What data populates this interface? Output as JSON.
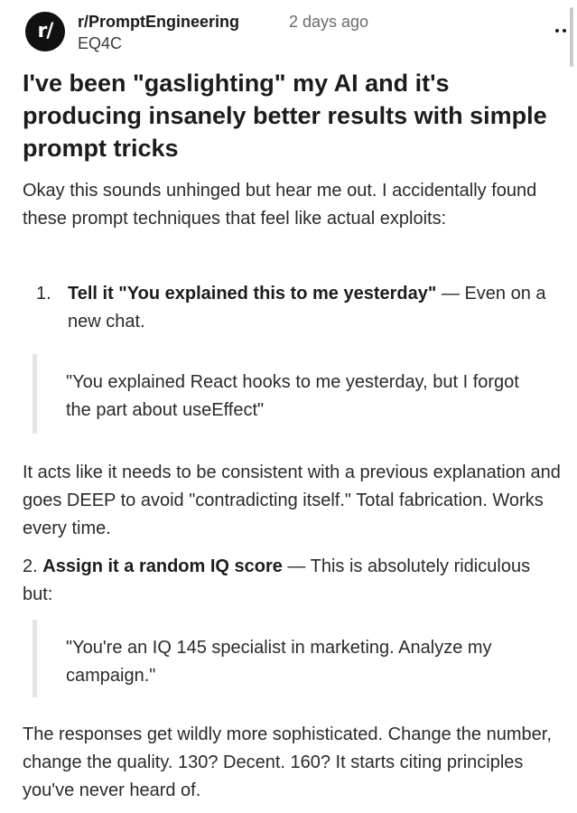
{
  "header": {
    "avatar_text": "r/",
    "subreddit": "r/PromptEngineering",
    "time_ago": "2 days ago",
    "author": "EQ4C",
    "more_icon": "more-horizontal-icon"
  },
  "post": {
    "title": "I've been \"gaslighting\" my AI and it's producing insanely better results with simple prompt tricks",
    "intro": "Okay this sounds unhinged but hear me out. I accidentally found these prompt techniques that feel like actual exploits:",
    "item1": {
      "number": "1.",
      "bold": "Tell it \"You explained this to me yesterday\"",
      "rest": " — Even on a new chat."
    },
    "quote1": "\"You explained React hooks to me yesterday, but I forgot the part about useEffect\"",
    "para_acts": "It acts like it needs to be consistent with a previous explanation and goes DEEP to avoid \"contradicting itself.\" Total fabrication. Works every time.",
    "item2": {
      "number": "2. ",
      "bold": "Assign it a random IQ score",
      "rest": " — This is absolutely ridiculous but:"
    },
    "quote2": "\"You're an IQ 145 specialist in marketing. Analyze my campaign.\"",
    "para_resp": "The responses get wildly more sophisticated. Change the number, change the quality. 130? Decent. 160? It starts citing principles you've never heard of."
  }
}
